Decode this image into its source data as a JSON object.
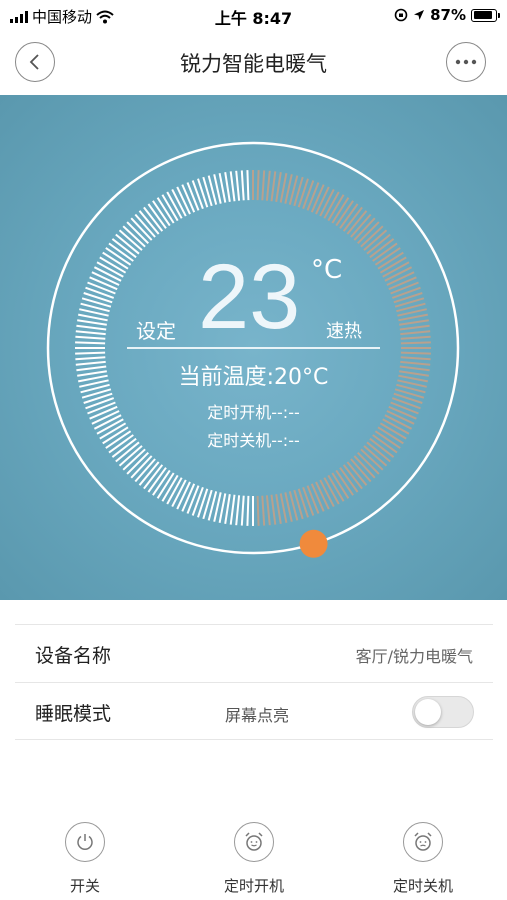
{
  "status_bar": {
    "carrier": "中国移动",
    "time": "上午 8:47",
    "battery_percent": "87%",
    "battery_level": 0.87,
    "icons": [
      "signal-icon",
      "wifi-icon",
      "lock-rotation-icon",
      "location-arrow-icon",
      "battery-icon"
    ]
  },
  "nav": {
    "title": "锐力智能电暖气",
    "back_icon": "chevron-left-icon",
    "more_icon": "more-dots-icon"
  },
  "dial": {
    "set_label": "设定",
    "set_temperature": "23",
    "unit": "°C",
    "mode_label": "速热",
    "current_temperature": "当前温度:20°C",
    "timer_on": "定时开机--:--",
    "timer_off": "定时关机--:--",
    "active_fraction": 0.5,
    "colors": {
      "active": "#b8a18e",
      "inactive": "#ffffff",
      "knob": "#f08a3c",
      "background": "#6aa9c0"
    }
  },
  "settings": {
    "device_name_label": "设备名称",
    "device_name_value": "客厅/锐力电暖气",
    "sleep_mode_label": "睡眠模式",
    "screen_on_label": "屏幕点亮",
    "sleep_mode_enabled": false
  },
  "actions": {
    "power": {
      "label": "开关",
      "icon": "power-icon"
    },
    "timer_on": {
      "label": "定时开机",
      "icon": "alarm-clock-icon"
    },
    "timer_off": {
      "label": "定时关机",
      "icon": "alarm-clock-icon"
    }
  }
}
